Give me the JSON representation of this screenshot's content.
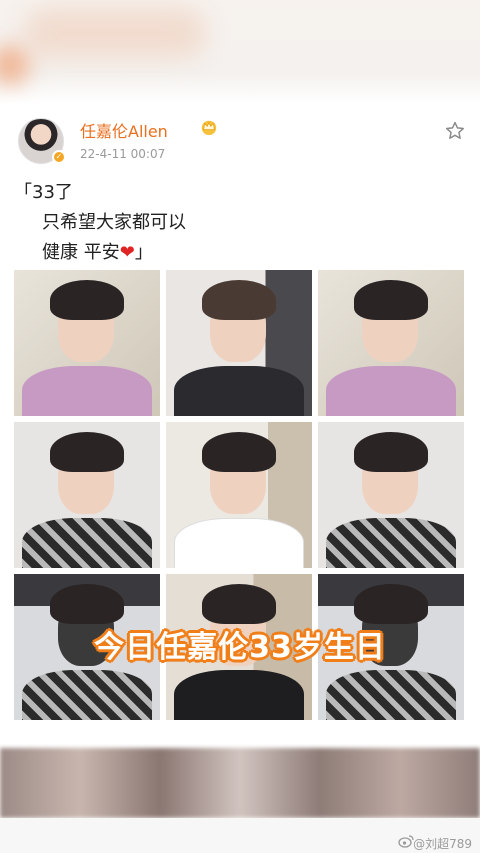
{
  "post": {
    "username": "任嘉伦Allen",
    "timestamp": "22-4-11 00:07",
    "text_lines": [
      "「33了",
      "只希望大家都可以",
      "健康 平安"
    ],
    "text_end": "」",
    "heart": "❤"
  },
  "icons": {
    "verified": "verified-badge-icon",
    "crown": "crown-icon",
    "star": "star-outline-icon",
    "weibo": "weibo-logo-icon"
  },
  "photos": [
    {
      "label": "photo-1"
    },
    {
      "label": "photo-2"
    },
    {
      "label": "photo-3"
    },
    {
      "label": "photo-4"
    },
    {
      "label": "photo-5"
    },
    {
      "label": "photo-6"
    },
    {
      "label": "photo-7"
    },
    {
      "label": "photo-8"
    },
    {
      "label": "photo-9"
    }
  ],
  "overlay_caption": "今日任嘉伦33岁生日",
  "watermark": "@刘超789",
  "colors": {
    "username": "#e86f1e",
    "caption_outline": "#f07f1a",
    "timestamp": "#9a9a9a"
  }
}
